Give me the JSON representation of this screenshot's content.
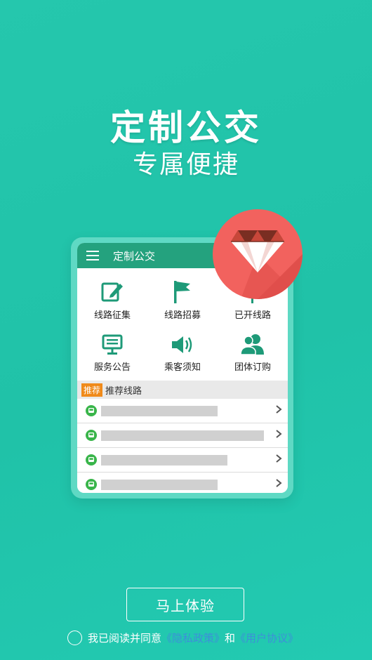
{
  "hero": {
    "title": "定制公交",
    "subtitle": "专属便捷"
  },
  "mockup": {
    "app_title": "定制公交",
    "features": [
      {
        "label": "线路征集",
        "icon": "edit-icon"
      },
      {
        "label": "线路招募",
        "icon": "flag-icon"
      },
      {
        "label": "已开线路",
        "icon": "route-icon"
      },
      {
        "label": "服务公告",
        "icon": "notice-board-icon"
      },
      {
        "label": "乘客须知",
        "icon": "speaker-icon"
      },
      {
        "label": "团体订购",
        "icon": "group-icon"
      }
    ],
    "recommend": {
      "tag": "推荐",
      "title": "推荐线路"
    },
    "routes_count_shown": 4
  },
  "badge": {
    "icon": "diamond-icon",
    "color": "#f2625e"
  },
  "cta": {
    "label": "马上体验"
  },
  "agreement": {
    "prefix": "我已阅读并同意",
    "privacy_link": "《隐私政策》",
    "and": "和",
    "user_link": "《用户协议》",
    "link_color": "#3d8fd9"
  },
  "colors": {
    "background": "#22c5ab",
    "appbar": "#24a27e",
    "icon_green": "#1e9a78"
  }
}
